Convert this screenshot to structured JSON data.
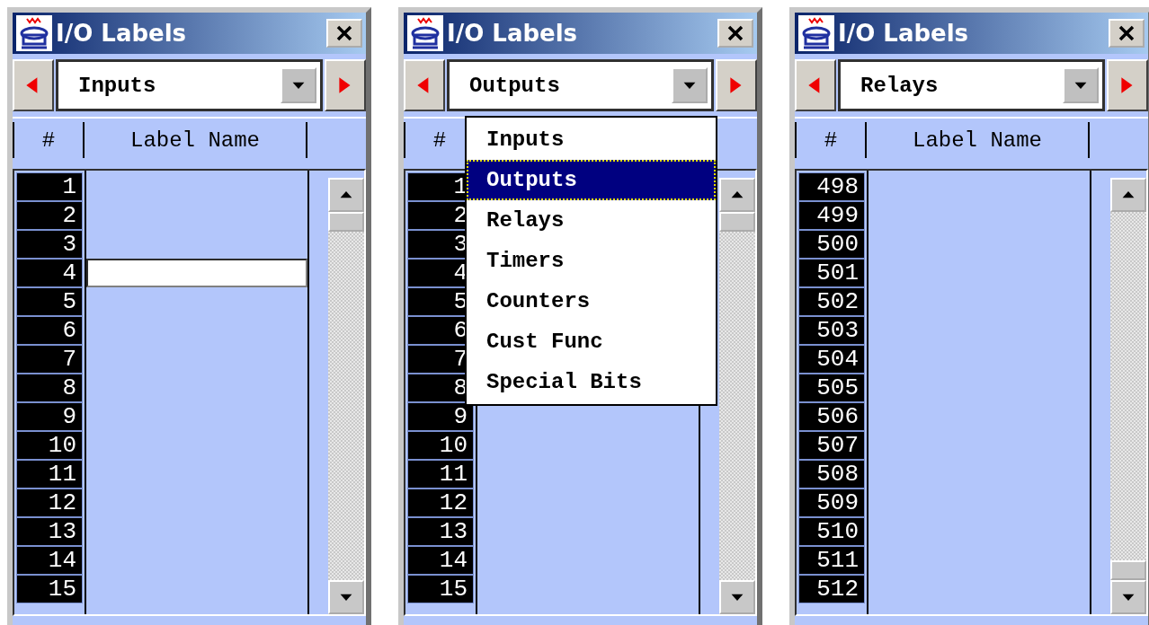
{
  "windows": [
    {
      "title": "I/O Labels",
      "category": "Inputs",
      "columns": [
        "#",
        "Label Name"
      ],
      "scrolled_to_end": false,
      "rows": [
        {
          "number": "1",
          "editing": false
        },
        {
          "number": "2",
          "editing": false
        },
        {
          "number": "3",
          "editing": false
        },
        {
          "number": "4",
          "editing": true
        },
        {
          "number": "5",
          "editing": false
        },
        {
          "number": "6",
          "editing": false
        },
        {
          "number": "7",
          "editing": false
        },
        {
          "number": "8",
          "editing": false
        },
        {
          "number": "9",
          "editing": false
        },
        {
          "number": "10",
          "editing": false
        },
        {
          "number": "11",
          "editing": false
        },
        {
          "number": "12",
          "editing": false
        },
        {
          "number": "13",
          "editing": false
        },
        {
          "number": "14",
          "editing": false
        },
        {
          "number": "15",
          "editing": false
        }
      ]
    },
    {
      "title": "I/O Labels",
      "category": "Outputs",
      "columns": [
        "#"
      ],
      "scrolled_to_end": false,
      "menu": {
        "items": [
          {
            "label": "Inputs",
            "selected": false
          },
          {
            "label": "Outputs",
            "selected": true
          },
          {
            "label": "Relays",
            "selected": false
          },
          {
            "label": "Timers",
            "selected": false
          },
          {
            "label": "Counters",
            "selected": false
          },
          {
            "label": "Cust Func",
            "selected": false
          },
          {
            "label": "Special Bits",
            "selected": false
          }
        ]
      },
      "rows": [
        {
          "number": "1",
          "editing": false
        },
        {
          "number": "2",
          "editing": false
        },
        {
          "number": "3",
          "editing": false
        },
        {
          "number": "4",
          "editing": false
        },
        {
          "number": "5",
          "editing": false
        },
        {
          "number": "6",
          "editing": false
        },
        {
          "number": "7",
          "editing": false
        },
        {
          "number": "8",
          "editing": false
        },
        {
          "number": "9",
          "editing": false
        },
        {
          "number": "10",
          "editing": false
        },
        {
          "number": "11",
          "editing": false
        },
        {
          "number": "12",
          "editing": false
        },
        {
          "number": "13",
          "editing": false
        },
        {
          "number": "14",
          "editing": false
        },
        {
          "number": "15",
          "editing": false
        }
      ]
    },
    {
      "title": "I/O Labels",
      "category": "Relays",
      "columns": [
        "#",
        "Label Name"
      ],
      "scrolled_to_end": true,
      "rows": [
        {
          "number": "498",
          "editing": false
        },
        {
          "number": "499",
          "editing": false
        },
        {
          "number": "500",
          "editing": false
        },
        {
          "number": "501",
          "editing": false
        },
        {
          "number": "502",
          "editing": false
        },
        {
          "number": "503",
          "editing": false
        },
        {
          "number": "504",
          "editing": false
        },
        {
          "number": "505",
          "editing": false
        },
        {
          "number": "506",
          "editing": false
        },
        {
          "number": "507",
          "editing": false
        },
        {
          "number": "508",
          "editing": false
        },
        {
          "number": "509",
          "editing": false
        },
        {
          "number": "510",
          "editing": false
        },
        {
          "number": "511",
          "editing": false
        },
        {
          "number": "512",
          "editing": false
        }
      ]
    }
  ]
}
